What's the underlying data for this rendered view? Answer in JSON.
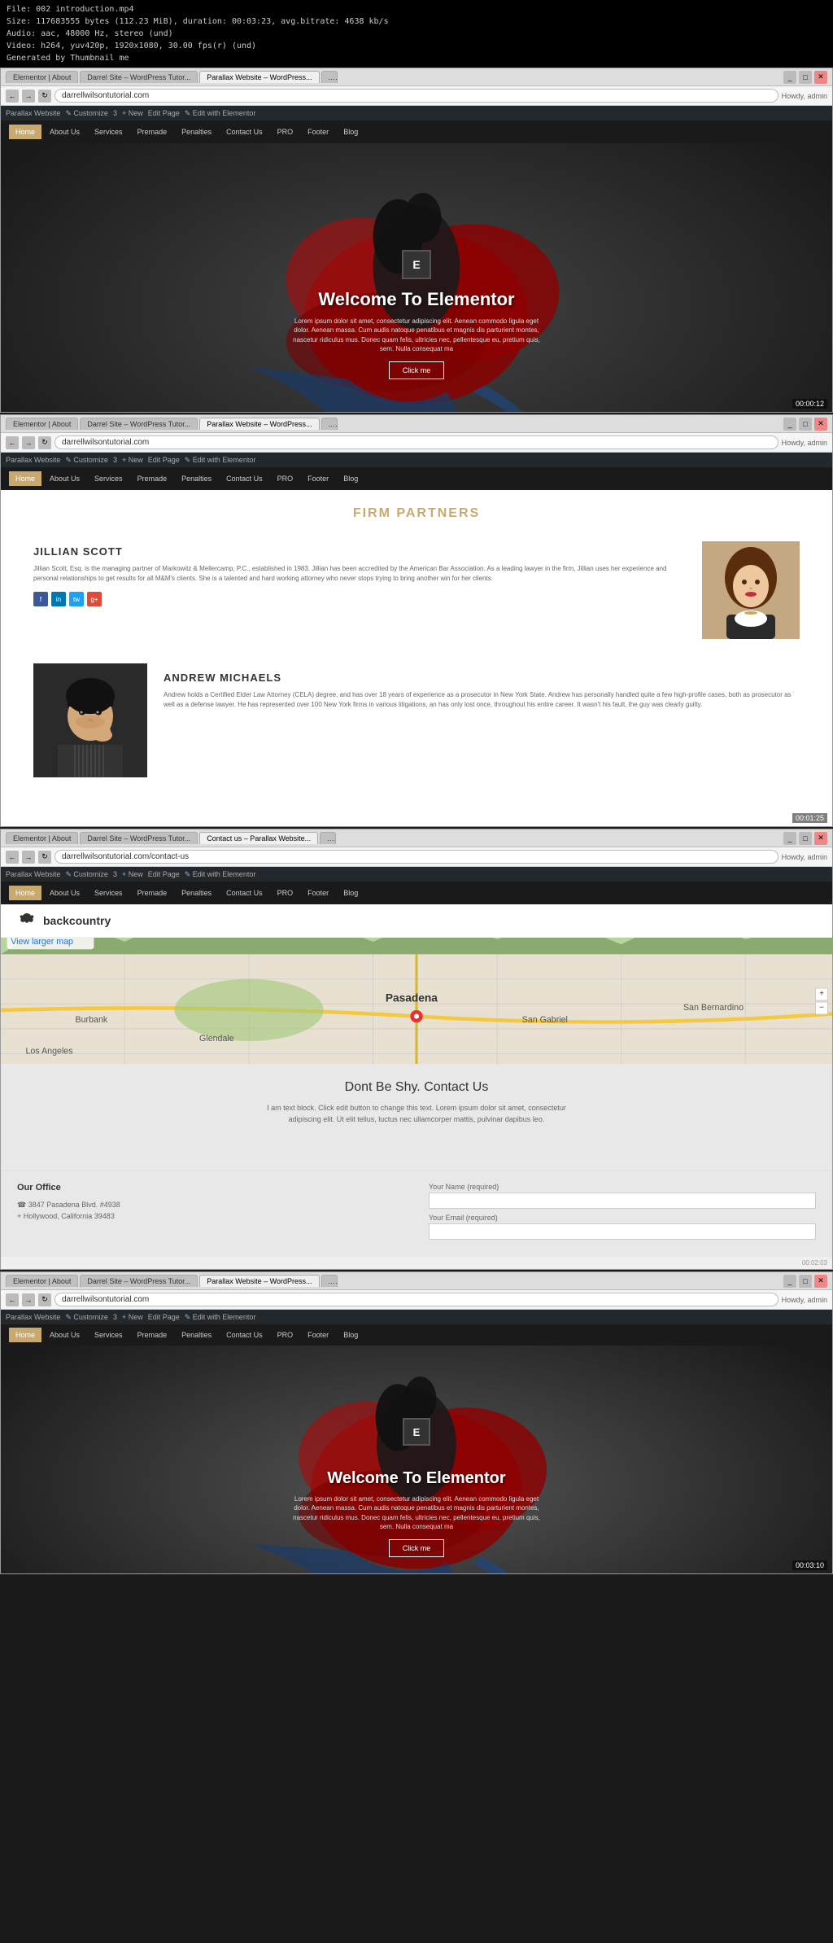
{
  "video_info": {
    "file": "File: 002 introduction.mp4",
    "size": "Size: 117683555 bytes (112.23 MiB), duration: 00:03:23, avg.bitrate: 4638 kb/s",
    "audio": "Audio: aac, 48000 Hz, stereo (und)",
    "video_spec": "Video: h264, yuv420p, 1920x1080, 30.00 fps(r) (und)",
    "generated": "Generated by Thumbnail me"
  },
  "browser1": {
    "tabs": [
      {
        "label": "Elementor | About",
        "active": false
      },
      {
        "label": "Darrel Site – WordPress Tutor...",
        "active": false
      },
      {
        "label": "Parallax Website – WordPress...",
        "active": true
      }
    ],
    "address": "darrellwilsontutorial.com",
    "wp_items": [
      "Parallax Website",
      "Customize",
      "3",
      "New",
      "Edit Page",
      "Edit with Elementor"
    ],
    "admin": "Howdy, admin"
  },
  "nav": {
    "items": [
      "Home",
      "About Us",
      "Services",
      "Premade",
      "Penalties",
      "Contact Us",
      "PRO",
      "Footer",
      "Blog"
    ]
  },
  "hero": {
    "title": "Welcome To Elementor",
    "subtitle": "Lorem ipsum dolor sit amet, consectetur adipiscing elit. Aenean commodo ligula eget dolor. Aenean massa. Cum audis natoque penatibus et magnis dis parturient montes, nascetur ridiculus mus. Donec quam felis, ultricies nec, pellentesque eu, pretium quis, sem. Nulla consequat ma",
    "button_label": "Click me",
    "timestamp": "00:00:12"
  },
  "browser2": {
    "tabs": [
      {
        "label": "Elementor | About",
        "active": false
      },
      {
        "label": "Darrel Site – WordPress Tutor...",
        "active": false
      },
      {
        "label": "Parallax Website – WordPress...",
        "active": true
      }
    ],
    "address": "darrellwilsontutorial.com",
    "timestamp": "00:01:25"
  },
  "firm_partners": {
    "title": "FIRM PARTNERS",
    "partners": [
      {
        "name": "JILLIAN SCOTT",
        "desc": "Jillian Scott, Esq. is the managing partner of Markowitz & Mellercamp, P.C., established in 1983. Jillian has been accredited by the American Bar Association. As a leading lawyer in the firm, Jillian uses her experience and personal relationships to get results for all M&M's clients. She is a talented and hard working attorney who never stops trying to bring another win for her clients.",
        "social": [
          "f",
          "in",
          "tw",
          "g+"
        ]
      },
      {
        "name": "ANDREW MICHAELS",
        "desc": "Andrew holds a Certified Elder Law Attorney (CELA) degree, and has over 18 years of experience as a prosecutor in New York State. Andrew has personally handled quite a few high-profile cases, both as prosecutor as well as a defense lawyer. He has represented over 100 New York firms in various litigations, an has only lost once, throughout his entire career. It wasn't his fault, the guy was clearly guilty."
      }
    ]
  },
  "browser3": {
    "tabs": [
      {
        "label": "Elementor | About",
        "active": false
      },
      {
        "label": "Darrel Site – WordPress Tutor...",
        "active": false
      },
      {
        "label": "Contact us – Parallax Website...",
        "active": true
      }
    ],
    "address": "darrellwilsontutorial.com/contact-us",
    "timestamp": "00:02:03"
  },
  "backcountry": {
    "logo": "backcountry"
  },
  "contact_section": {
    "map_label": "Pasadena",
    "view_larger": "View larger map",
    "title": "Dont Be Shy. Contact Us",
    "description": "I am text block. Click edit button to change this text. Lorem ipsum dolor sit amet, consectetur adipiscing elit. Ut elit tellus, luctus nec ullamcorper mattis, pulvinar dapibus leo.",
    "office": {
      "title": "Our Office",
      "address_line1": "☎ 3847 Pasadena Blvd. #4938",
      "address_line2": "+ Hollywood, California 39483"
    },
    "form": {
      "name_label": "Your Name (required)",
      "email_label": "Your Email (required)"
    }
  },
  "browser4": {
    "tabs": [
      {
        "label": "Elementor | About",
        "active": false
      },
      {
        "label": "Darrel Site – WordPress Tutor...",
        "active": false
      },
      {
        "label": "Parallax Website – WordPress...",
        "active": true
      }
    ],
    "address": "darrellwilsontutorial.com",
    "timestamp": "00:03:10"
  },
  "hero2": {
    "title": "Welcome To Elementor",
    "subtitle": "Lorem ipsum dolor sit amet, consectetur adipiscing elit. Aenean commodo ligula eget dolor. Aenean massa. Cum audis natoque penatibus et magnis dis parturient montes, nascetur ridiculus mus. Donec quam felis, ultricies nec, pellentesque eu, pretium quis, sem. Nulla consequat ma",
    "button_label": "Click me",
    "timestamp": "00:03:10"
  }
}
